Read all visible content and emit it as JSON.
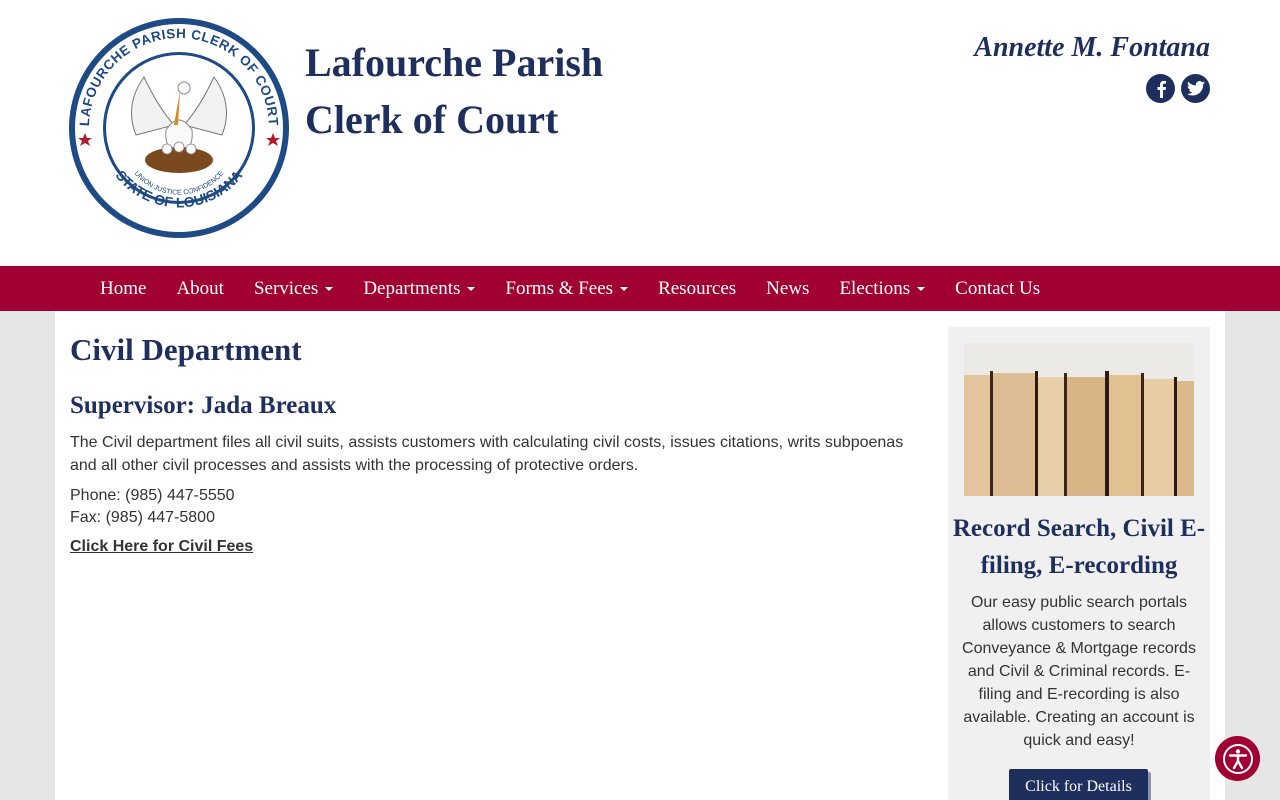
{
  "header": {
    "seal_text_top": "LAFOURCHE PARISH CLERK OF COURT",
    "seal_text_bottom": "STATE OF LOUISIANA",
    "seal_motto": "UNION JUSTICE CONFIDENCE",
    "title_line1": "Lafourche Parish",
    "title_line2": "Clerk of Court",
    "clerk_name": "Annette M. Fontana",
    "social": [
      "facebook-icon",
      "twitter-icon"
    ]
  },
  "nav": {
    "items": [
      {
        "label": "Home",
        "dropdown": false
      },
      {
        "label": "About",
        "dropdown": false
      },
      {
        "label": "Services",
        "dropdown": true
      },
      {
        "label": "Departments",
        "dropdown": true
      },
      {
        "label": "Forms & Fees",
        "dropdown": true
      },
      {
        "label": "Resources",
        "dropdown": false
      },
      {
        "label": "News",
        "dropdown": false
      },
      {
        "label": "Elections",
        "dropdown": true
      },
      {
        "label": "Contact Us",
        "dropdown": false
      }
    ]
  },
  "main": {
    "title": "Civil Department",
    "supervisor": "Supervisor: Jada Breaux",
    "description": "The Civil department files all civil suits, assists customers with calculating civil costs, issues citations, writs subpoenas and all other civil processes and assists with the processing of protective orders.",
    "phone": "Phone: (985) 447-5550",
    "fax": "Fax: (985) 447-5800",
    "fees_link": "Click Here for Civil Fees"
  },
  "sidebar": {
    "promo_title": "Record Search, Civil E-filing, E-recording",
    "promo_text": "Our easy public search portals allows customers to search Conveyance & Mortgage records and Civil & Criminal records. E-filing and E-recording is also available. Creating an account is quick and easy!",
    "button_label": "Click for Details"
  },
  "colors": {
    "brand_navy": "#1e2f5e",
    "nav_red": "#a00032",
    "page_bg": "#e6e6e6"
  },
  "accessibility_icon": "accessibility-icon"
}
